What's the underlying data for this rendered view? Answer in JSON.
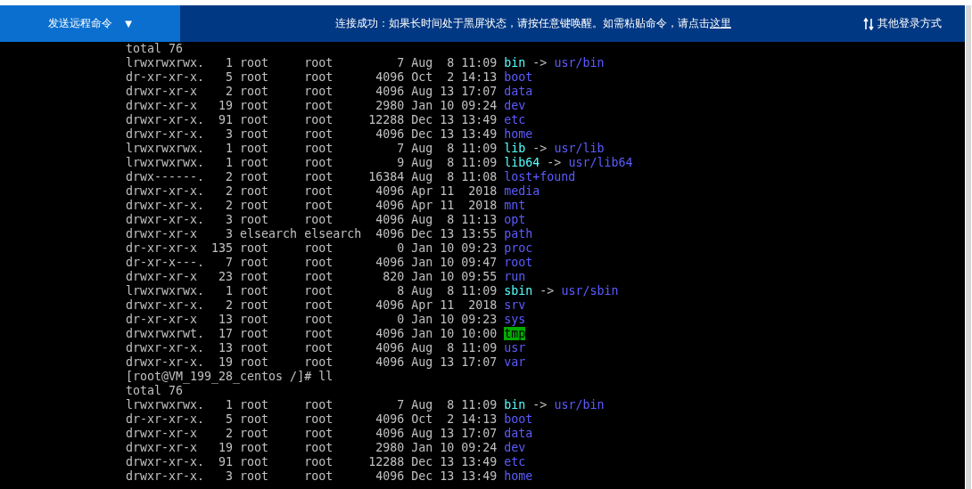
{
  "toolbar": {
    "send_button": {
      "label": "发送远程命令",
      "caret": "▼"
    },
    "notice": {
      "text": "连接成功：如果长时间处于黑屏状态，请按任意键唤醒。如需粘贴命令，请点击",
      "link": "这里"
    },
    "other_login": {
      "label": "其他登录方式"
    }
  },
  "terminal": {
    "lines": [
      {
        "kind": "text",
        "text": "total 76"
      },
      {
        "kind": "link",
        "info": "lrwxrwxrwx.   1 root     root         7 Aug  8 11:09",
        "name": "bin",
        "arrow": "->",
        "target": "usr/bin"
      },
      {
        "kind": "dir",
        "info": "dr-xr-xr-x.   5 root     root      4096 Oct  2 14:13",
        "name": "boot"
      },
      {
        "kind": "dir",
        "info": "drwxr-xr-x    2 root     root      4096 Aug 13 17:07",
        "name": "data"
      },
      {
        "kind": "dir",
        "info": "drwxr-xr-x   19 root     root      2980 Jan 10 09:24",
        "name": "dev"
      },
      {
        "kind": "dir",
        "info": "drwxr-xr-x.  91 root     root     12288 Dec 13 13:49",
        "name": "etc"
      },
      {
        "kind": "dir",
        "info": "drwxr-xr-x.   3 root     root      4096 Dec 13 13:49",
        "name": "home"
      },
      {
        "kind": "link",
        "info": "lrwxrwxrwx.   1 root     root         7 Aug  8 11:09",
        "name": "lib",
        "arrow": "->",
        "target": "usr/lib"
      },
      {
        "kind": "link",
        "info": "lrwxrwxrwx.   1 root     root         9 Aug  8 11:09",
        "name": "lib64",
        "arrow": "->",
        "target": "usr/lib64"
      },
      {
        "kind": "dir",
        "info": "drwx------.   2 root     root     16384 Aug  8 11:08",
        "name": "lost+found"
      },
      {
        "kind": "dir",
        "info": "drwxr-xr-x.   2 root     root      4096 Apr 11  2018",
        "name": "media"
      },
      {
        "kind": "dir",
        "info": "drwxr-xr-x.   2 root     root      4096 Apr 11  2018",
        "name": "mnt"
      },
      {
        "kind": "dir",
        "info": "drwxr-xr-x.   3 root     root      4096 Aug  8 11:13",
        "name": "opt"
      },
      {
        "kind": "dir",
        "info": "drwxr-xr-x    3 elsearch elsearch  4096 Dec 13 13:55",
        "name": "path"
      },
      {
        "kind": "dir",
        "info": "dr-xr-xr-x  135 root     root         0 Jan 10 09:23",
        "name": "proc"
      },
      {
        "kind": "dir",
        "info": "dr-xr-x---.   7 root     root      4096 Jan 10 09:47",
        "name": "root"
      },
      {
        "kind": "dir",
        "info": "drwxr-xr-x   23 root     root       820 Jan 10 09:55",
        "name": "run"
      },
      {
        "kind": "link",
        "info": "lrwxrwxrwx.   1 root     root         8 Aug  8 11:09",
        "name": "sbin",
        "arrow": "->",
        "target": "usr/sbin"
      },
      {
        "kind": "dir",
        "info": "drwxr-xr-x.   2 root     root      4096 Apr 11  2018",
        "name": "srv"
      },
      {
        "kind": "dir",
        "info": "dr-xr-xr-x   13 root     root         0 Jan 10 09:23",
        "name": "sys"
      },
      {
        "kind": "sticky",
        "info": "drwxrwxrwt.  17 root     root      4096 Jan 10 10:00",
        "name": "tmp"
      },
      {
        "kind": "dir",
        "info": "drwxr-xr-x.  13 root     root      4096 Aug  8 11:09",
        "name": "usr"
      },
      {
        "kind": "dir",
        "info": "drwxr-xr-x.  19 root     root      4096 Aug 13 17:07",
        "name": "var"
      },
      {
        "kind": "text",
        "text": "[root@VM_199_28_centos /]# ll"
      },
      {
        "kind": "text",
        "text": "total 76"
      },
      {
        "kind": "link",
        "info": "lrwxrwxrwx.   1 root     root         7 Aug  8 11:09",
        "name": "bin",
        "arrow": "->",
        "target": "usr/bin"
      },
      {
        "kind": "dir",
        "info": "dr-xr-xr-x.   5 root     root      4096 Oct  2 14:13",
        "name": "boot"
      },
      {
        "kind": "dir",
        "info": "drwxr-xr-x    2 root     root      4096 Aug 13 17:07",
        "name": "data"
      },
      {
        "kind": "dir",
        "info": "drwxr-xr-x   19 root     root      2980 Jan 10 09:24",
        "name": "dev"
      },
      {
        "kind": "dir",
        "info": "drwxr-xr-x.  91 root     root     12288 Dec 13 13:49",
        "name": "etc"
      },
      {
        "kind": "dir",
        "info": "drwxr-xr-x.   3 root     root      4096 Dec 13 13:49",
        "name": "home"
      }
    ]
  }
}
